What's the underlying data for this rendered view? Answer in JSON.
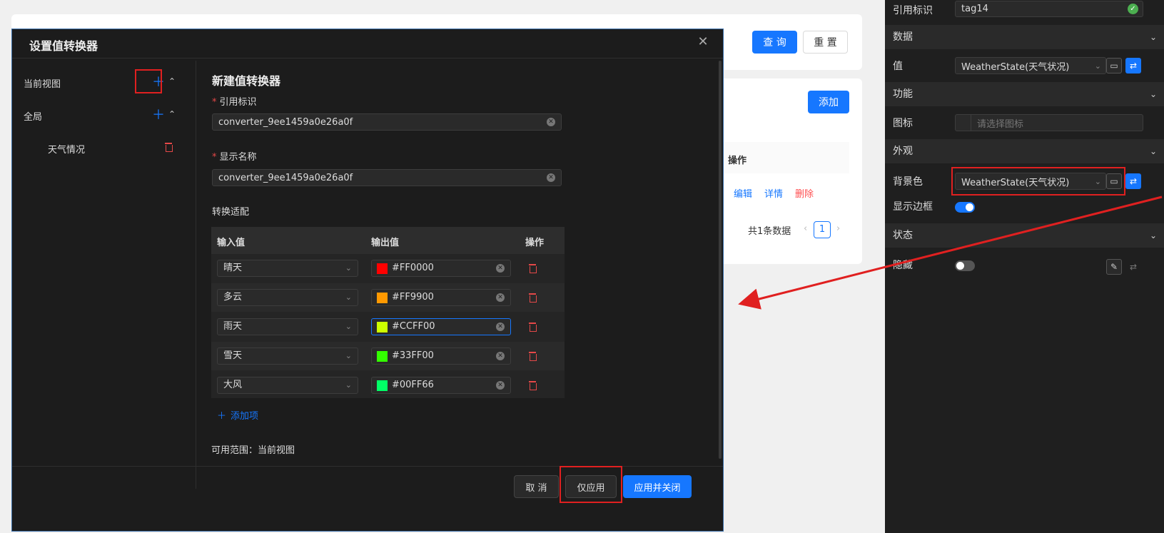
{
  "bg": {
    "query_btn": "查 询",
    "reset_btn": "重 置",
    "add_btn": "添加",
    "col_action": "操作",
    "row_actions": [
      "编辑",
      "详情",
      "删除"
    ],
    "total_text": "共1条数据",
    "page_current": "1"
  },
  "dialog": {
    "title": "设置值转换器",
    "left": {
      "current_view": "当前视图",
      "global": "全局",
      "items": [
        "天气情况"
      ]
    },
    "form": {
      "title": "新建值转换器",
      "ref_label": "引用标识",
      "ref_value": "converter_9ee1459a0e26a0f",
      "name_label": "显示名称",
      "name_value": "converter_9ee1459a0e26a0f",
      "mapping_label": "转换适配",
      "table": {
        "headers": [
          "输入值",
          "输出值",
          "操作"
        ],
        "rows": [
          {
            "input": "晴天",
            "output": "#FF0000",
            "color": "#FF0000"
          },
          {
            "input": "多云",
            "output": "#FF9900",
            "color": "#FF9900"
          },
          {
            "input": "雨天",
            "output": "#CCFF00",
            "color": "#CCFF00"
          },
          {
            "input": "雪天",
            "output": "#33FF00",
            "color": "#33FF00"
          },
          {
            "input": "大风",
            "output": "#00FF66",
            "color": "#00FF66"
          }
        ]
      },
      "add_item": "添加项",
      "scope": "可用范围：当前视图"
    },
    "footer": {
      "cancel": "取 消",
      "apply_only": "仅应用",
      "apply_close": "应用并关闭"
    }
  },
  "right_panel": {
    "ref_label": "引用标识",
    "ref_value": "tag14",
    "sec_data": "数据",
    "value_label": "值",
    "value_select": "WeatherState(天气状况)",
    "sec_function": "功能",
    "icon_label": "图标",
    "icon_placeholder": "请选择图标",
    "sec_appearance": "外观",
    "bg_color_label": "背景色",
    "bg_color_select": "WeatherState(天气状况)",
    "border_label": "显示边框",
    "border_on": true,
    "sec_state": "状态",
    "hidden_label": "隐藏",
    "hidden_on": false
  },
  "colors": {
    "accent": "#1677ff",
    "danger": "#e54848",
    "highlight": "#e02020"
  }
}
